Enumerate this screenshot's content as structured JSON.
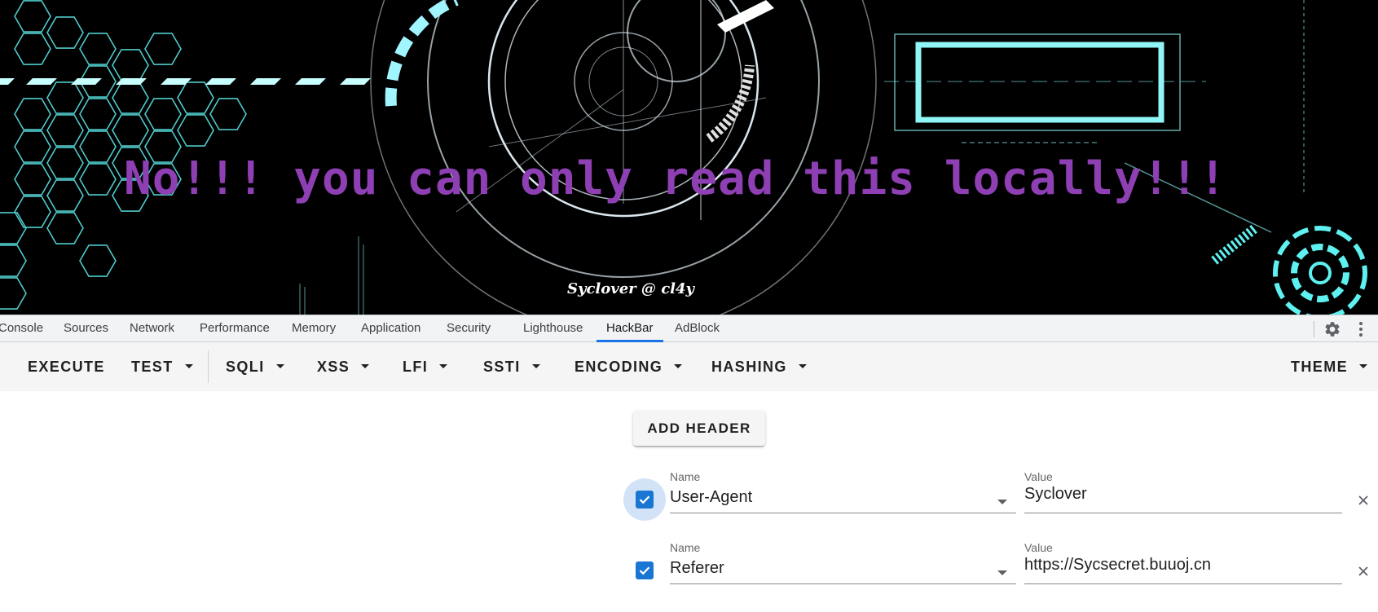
{
  "page": {
    "headline": "No!!! you can only read this locally!!!",
    "signature": "Syclover @ cl4y",
    "colors": {
      "headline": "#8e3fb3",
      "background": "#000000",
      "cyan_art": "#5ff0f0"
    }
  },
  "devtools": {
    "tabs": [
      {
        "label": "Console",
        "active": false
      },
      {
        "label": "Sources",
        "active": false
      },
      {
        "label": "Network",
        "active": false
      },
      {
        "label": "Performance",
        "active": false
      },
      {
        "label": "Memory",
        "active": false
      },
      {
        "label": "Application",
        "active": false
      },
      {
        "label": "Security",
        "active": false
      },
      {
        "label": "Lighthouse",
        "active": false
      },
      {
        "label": "HackBar",
        "active": true
      },
      {
        "label": "AdBlock",
        "active": false
      }
    ],
    "icons": [
      "gear-icon",
      "more-vertical-icon"
    ],
    "accent": "#1a73e8"
  },
  "hackbar": {
    "toolbar": {
      "execute": "EXECUTE",
      "test": "TEST",
      "sqli": "SQLI",
      "xss": "XSS",
      "lfi": "LFI",
      "ssti": "SSTI",
      "encoding": "ENCODING",
      "hashing": "HASHING",
      "theme": "THEME"
    },
    "add_header_label": "ADD HEADER",
    "headers": [
      {
        "enabled": true,
        "name_label": "Name",
        "name": "User-Agent",
        "value_label": "Value",
        "value": "Syclover"
      },
      {
        "enabled": true,
        "name_label": "Name",
        "name": "Referer",
        "value_label": "Value",
        "value": "https://Sycsecret.buuoj.cn"
      }
    ],
    "checkbox_color": "#1976d2"
  }
}
